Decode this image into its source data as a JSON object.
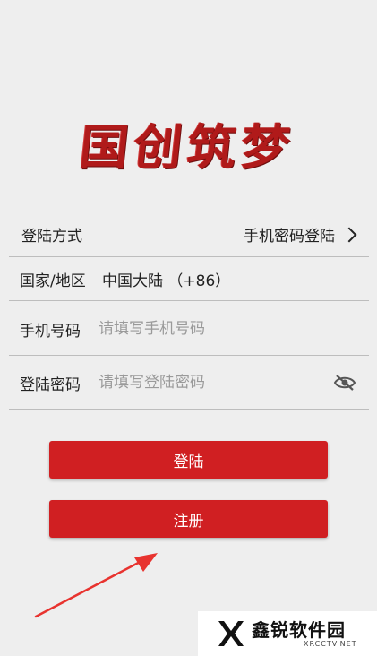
{
  "logo": {
    "text": "国创筑梦"
  },
  "form": {
    "login_method": {
      "label": "登陆方式",
      "value": "手机密码登陆"
    },
    "region": {
      "label": "国家/地区",
      "value": "中国大陆 （+86）"
    },
    "phone": {
      "label": "手机号码",
      "placeholder": "请填写手机号码",
      "value": ""
    },
    "password": {
      "label": "登陆密码",
      "placeholder": "请填写登陆密码",
      "value": ""
    }
  },
  "buttons": {
    "login": "登陆",
    "register": "注册"
  },
  "watermark": {
    "title": "鑫锐软件园",
    "subtitle": "XRCCTV.NET"
  },
  "colors": {
    "background": "#eeeeee",
    "primary": "#d01f22",
    "logo_red": "#b01a1a",
    "divider": "#bdbdbd",
    "placeholder": "#9a9a9a",
    "annotation_arrow": "#e8332f"
  },
  "icons": {
    "method_chevron": "chevron-right-icon",
    "password_toggle": "eye-slash-icon",
    "annotation": "arrow-annotation-icon",
    "watermark_logo": "x-logo-icon"
  }
}
